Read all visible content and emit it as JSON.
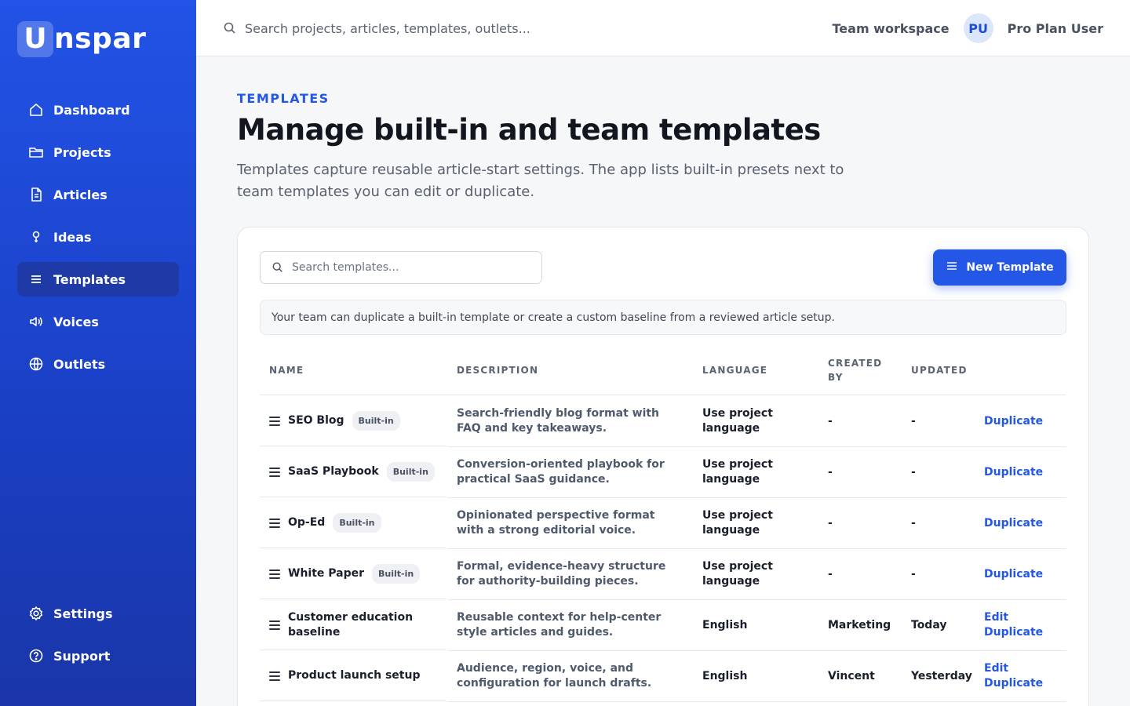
{
  "brand": {
    "mark": "U",
    "name": "nspar"
  },
  "sidebar": {
    "items": [
      {
        "label": "Dashboard",
        "icon": "home-icon"
      },
      {
        "label": "Projects",
        "icon": "folder-icon"
      },
      {
        "label": "Articles",
        "icon": "document-icon"
      },
      {
        "label": "Ideas",
        "icon": "lightbulb-icon"
      },
      {
        "label": "Templates",
        "icon": "list-icon",
        "active": true
      },
      {
        "label": "Voices",
        "icon": "speaker-icon"
      },
      {
        "label": "Outlets",
        "icon": "globe-icon"
      }
    ],
    "bottom": [
      {
        "label": "Settings",
        "icon": "gear-icon"
      },
      {
        "label": "Support",
        "icon": "help-icon"
      }
    ]
  },
  "topbar": {
    "search_placeholder": "Search projects, articles, templates, outlets...",
    "workspace": "Team workspace",
    "avatar_initials": "PU",
    "user_name": "Pro Plan User"
  },
  "page": {
    "eyebrow": "TEMPLATES",
    "title": "Manage built-in and team templates",
    "description": "Templates capture reusable article-start settings. The app lists built-in presets next to team templates you can edit or duplicate."
  },
  "card": {
    "search_placeholder": "Search templates...",
    "new_button": "New Template",
    "info": "Your team can duplicate a built-in template or create a custom baseline from a reviewed article setup."
  },
  "table": {
    "headers": {
      "name": "NAME",
      "description": "DESCRIPTION",
      "language": "LANGUAGE",
      "created_by": "CREATED BY",
      "updated": "UPDATED"
    },
    "rows": [
      {
        "name": "SEO Blog",
        "badge": "Built-in",
        "description": "Search-friendly blog format with FAQ and key takeaways.",
        "language": "Use project language",
        "created_by": "-",
        "updated": "-",
        "actions": [
          "Duplicate"
        ]
      },
      {
        "name": "SaaS Playbook",
        "badge": "Built-in",
        "description": "Conversion-oriented playbook for practical SaaS guidance.",
        "language": "Use project language",
        "created_by": "-",
        "updated": "-",
        "actions": [
          "Duplicate"
        ]
      },
      {
        "name": "Op-Ed",
        "badge": "Built-in",
        "description": "Opinionated perspective format with a strong editorial voice.",
        "language": "Use project language",
        "created_by": "-",
        "updated": "-",
        "actions": [
          "Duplicate"
        ]
      },
      {
        "name": "White Paper",
        "badge": "Built-in",
        "description": "Formal, evidence-heavy structure for authority-building pieces.",
        "language": "Use project language",
        "created_by": "-",
        "updated": "-",
        "actions": [
          "Duplicate"
        ]
      },
      {
        "name": "Customer education baseline",
        "badge": "",
        "description": "Reusable context for help-center style articles and guides.",
        "language": "English",
        "created_by": "Marketing",
        "updated": "Today",
        "actions": [
          "Edit",
          "Duplicate"
        ]
      },
      {
        "name": "Product launch setup",
        "badge": "",
        "description": "Audience, region, voice, and configuration for launch drafts.",
        "language": "English",
        "created_by": "Vincent",
        "updated": "Yesterday",
        "actions": [
          "Edit",
          "Duplicate"
        ]
      }
    ]
  }
}
